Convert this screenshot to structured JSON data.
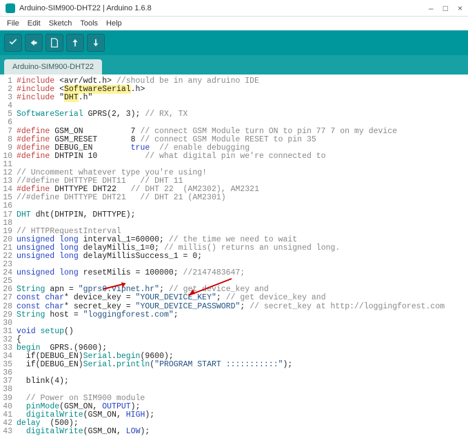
{
  "window": {
    "title": "Arduino-SIM900-DHT22 | Arduino 1.6.8",
    "minimize": "–",
    "maximize": "□",
    "close": "×"
  },
  "menu": {
    "file": "File",
    "edit": "Edit",
    "sketch": "Sketch",
    "tools": "Tools",
    "help": "Help"
  },
  "tab": {
    "active": "Arduino-SIM900-DHT22"
  },
  "code": {
    "lines": [
      {
        "n": "1",
        "pre": "#include",
        "mid": " <avr/wdt.h> ",
        "comm": "//should be in any adruino IDE"
      },
      {
        "n": "2",
        "pre": "#include",
        "mid": " <",
        "hl": "SoftwareSerial",
        "post": ".h>"
      },
      {
        "n": "3",
        "pre": "#include",
        "mid": " \"",
        "hl": "DHT",
        "post": ".h\""
      },
      {
        "n": "4",
        "raw": ""
      },
      {
        "n": "5",
        "teal": "SoftwareSerial",
        "rest": " GPRS(2, 3); ",
        "comm": "// RX, TX"
      },
      {
        "n": "6",
        "raw": ""
      },
      {
        "n": "7",
        "pre": "#define",
        "mid": " GSM_ON          7 ",
        "comm": "// connect GSM Module turn ON to pin 77 7 on my device"
      },
      {
        "n": "8",
        "pre": "#define",
        "mid": " GSM_RESET       8 ",
        "comm": "// connect GSM Module RESET to pin 35"
      },
      {
        "n": "9",
        "pre": "#define",
        "mid": " DEBUG_EN        ",
        "blue": "true",
        "mid2": "  ",
        "comm": "// enable debugging"
      },
      {
        "n": "10",
        "pre": "#define",
        "mid": " DHTPIN 10          ",
        "comm": "// what digital pin we're connected to"
      },
      {
        "n": "11",
        "raw": ""
      },
      {
        "n": "12",
        "comm": "// Uncomment whatever type you're using!"
      },
      {
        "n": "13",
        "comm": "//#define DHTTYPE DHT11   // DHT 11"
      },
      {
        "n": "14",
        "pre": "#define",
        "mid": " DHTTYPE DHT22   ",
        "comm": "// DHT 22  (AM2302), AM2321"
      },
      {
        "n": "15",
        "comm": "//#define DHTTYPE DHT21   // DHT 21 (AM2301)"
      },
      {
        "n": "16",
        "raw": ""
      },
      {
        "n": "17",
        "teal": "DHT",
        "rest": " dht(DHTPIN, DHTTYPE);"
      },
      {
        "n": "18",
        "raw": ""
      },
      {
        "n": "19",
        "comm": "// HTTPRequestInterval"
      },
      {
        "n": "20",
        "blue": "unsigned long",
        "rest": " interval_1=60000; ",
        "comm": "// the time we need to wait"
      },
      {
        "n": "21",
        "blue": "unsigned long",
        "rest": " delayMillis_1=0; ",
        "comm": "// millis() returns an unsigned long."
      },
      {
        "n": "22",
        "blue": "unsigned long",
        "rest": " delayMillisSuccess_1 = 0;"
      },
      {
        "n": "23",
        "raw": ""
      },
      {
        "n": "24",
        "blue": "unsigned long",
        "rest": " resetMilis = 100000; ",
        "comm": "//2147483647;"
      },
      {
        "n": "25",
        "raw": ""
      },
      {
        "n": "26",
        "teal": "String",
        "rest": " apn = ",
        "str": "\"gprs0.vipnet.hr\"",
        "rest2": "; ",
        "comm": "// get device_key and"
      },
      {
        "n": "27",
        "blue": "const char",
        "rest": "* device_key = ",
        "str": "\"YOUR_DEVICE_KEY\"",
        "rest2": "; ",
        "comm": "// get device_key and"
      },
      {
        "n": "28",
        "blue": "const char",
        "rest": "* secret_key = ",
        "str": "\"YOUR_DEVICE_PASSWORD\"",
        "rest2": "; ",
        "comm": "// secret_key at http://loggingforest.com"
      },
      {
        "n": "29",
        "teal": "String",
        "rest": " host = ",
        "str": "\"loggingforest.com\"",
        "rest2": ";"
      },
      {
        "n": "30",
        "raw": ""
      },
      {
        "n": "31",
        "blue": "void",
        "rest": " ",
        "teal": "setup",
        "rest2": "()"
      },
      {
        "n": "32",
        "raw": "{"
      },
      {
        "n": "33",
        "rest": "  GPRS.",
        "teal": "begin",
        "rest2": "(9600);"
      },
      {
        "n": "34",
        "rest": "  if(DEBUG_EN)",
        "teal2": "Serial",
        "rest2": ".",
        "teal3": "begin",
        "rest3": "(9600);"
      },
      {
        "n": "35",
        "rest": "  if(DEBUG_EN)",
        "teal2": "Serial",
        "rest2": ".",
        "teal3": "println",
        "rest3": "(",
        "str": "\"PROGRAM START :::::::::::\"",
        "rest4": ");"
      },
      {
        "n": "36",
        "raw": ""
      },
      {
        "n": "37",
        "rest": "  blink(4);"
      },
      {
        "n": "38",
        "raw": ""
      },
      {
        "n": "39",
        "comm": "  // Power on SIM900 module"
      },
      {
        "n": "40",
        "rest": "  ",
        "teal": "pinMode",
        "rest2": "(GSM_ON, ",
        "blue": "OUTPUT",
        "rest3": ");"
      },
      {
        "n": "41",
        "rest": "  ",
        "teal": "digitalWrite",
        "rest2": "(GSM_ON, ",
        "blue": "HIGH",
        "rest3": ");"
      },
      {
        "n": "42",
        "rest": "  ",
        "teal": "delay",
        "rest2": "(500);"
      },
      {
        "n": "43",
        "rest": "  ",
        "teal": "digitalWrite",
        "rest2": "(GSM_ON, ",
        "blue": "LOW",
        "rest3": ");"
      }
    ]
  }
}
